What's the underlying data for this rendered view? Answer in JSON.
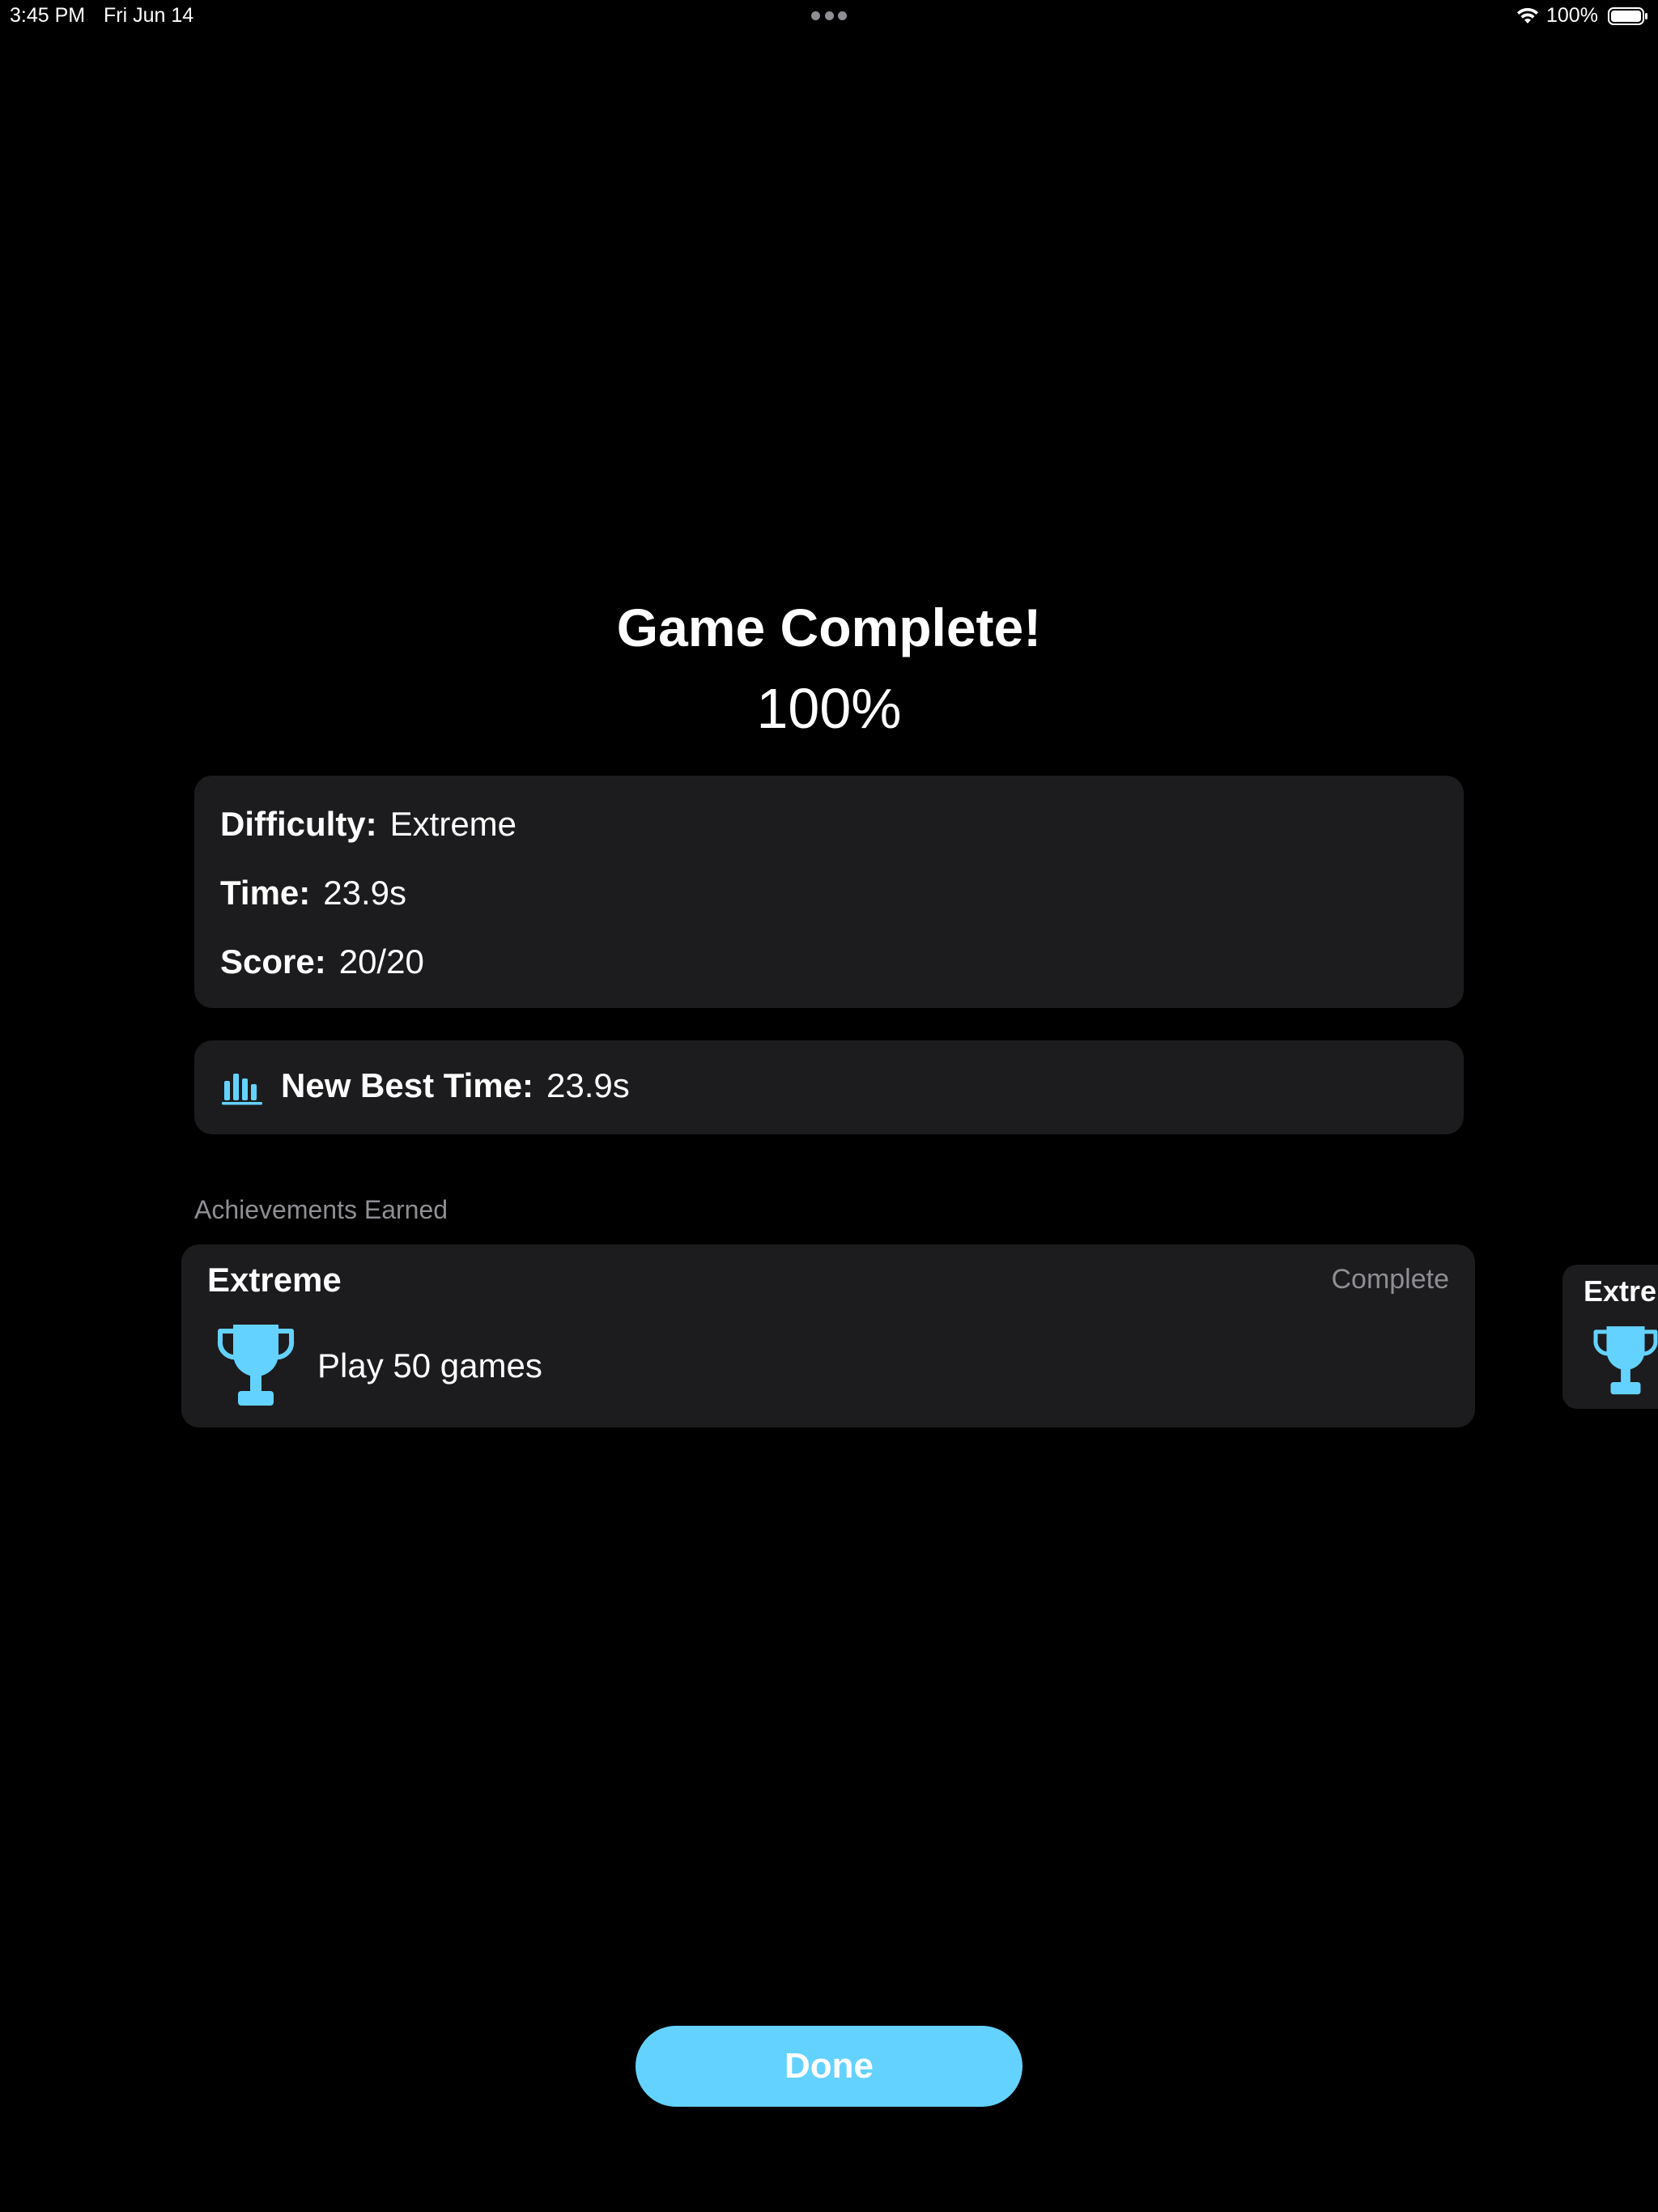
{
  "status_bar": {
    "time": "3:45 PM",
    "date": "Fri Jun 14",
    "battery_percent": "100%",
    "wifi_icon": "wifi-icon",
    "battery_icon": "battery-full-icon"
  },
  "result": {
    "title": "Game Complete!",
    "percent": "100%"
  },
  "stats": {
    "difficulty_label": "Difficulty:",
    "difficulty_value": "Extreme",
    "time_label": "Time:",
    "time_value": "23.9s",
    "score_label": "Score:",
    "score_value": "20/20"
  },
  "best_time": {
    "icon": "chart-bar-icon",
    "label": "New Best Time:",
    "value": "23.9s"
  },
  "achievements": {
    "header": "Achievements Earned",
    "items": [
      {
        "title": "Extreme",
        "status": "Complete",
        "icon": "trophy-icon",
        "description": "Play 50 games"
      },
      {
        "title": "Extreme",
        "icon": "trophy-icon"
      }
    ]
  },
  "actions": {
    "done_label": "Done"
  },
  "colors": {
    "background": "#000000",
    "card": "#1c1c1e",
    "accent": "#64d2ff",
    "secondary_text": "#8e8e93"
  }
}
